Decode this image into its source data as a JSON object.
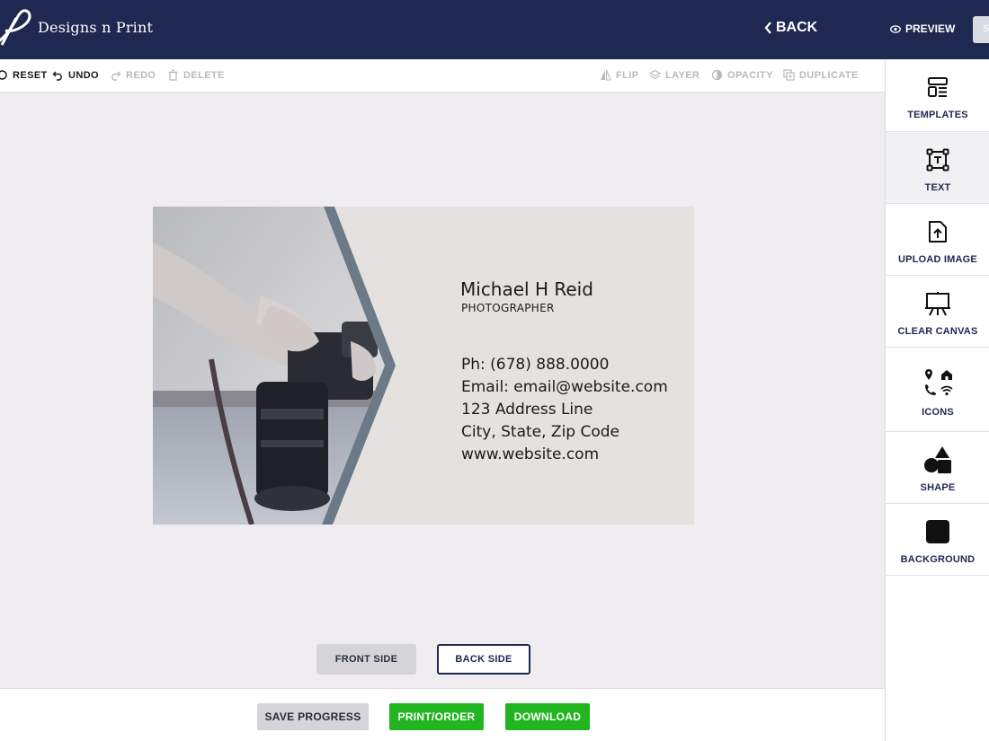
{
  "header": {
    "brand": "Designs n Print",
    "back_label": "BACK",
    "preview_label": "PREVIEW",
    "cut_button_label": "S"
  },
  "toolbar": {
    "reset": "RESET",
    "undo": "UNDO",
    "redo": "REDO",
    "delete": "DELETE",
    "flip": "FLIP",
    "layer": "LAYER",
    "opacity": "OPACITY",
    "duplicate": "DUPLICATE"
  },
  "card": {
    "name": "Michael H Reid",
    "title": "PHOTOGRAPHER",
    "phone": "Ph: (678) 888.0000",
    "email": "Email: email@website.com",
    "address": "123 Address Line",
    "city": "City, State, Zip Code",
    "website": "www.website.com",
    "accent_color": "#6b7a86"
  },
  "sides": {
    "front": "FRONT SIDE",
    "back": "BACK SIDE"
  },
  "bottom": {
    "save": "SAVE PROGRESS",
    "print": "PRINT/ORDER",
    "download": "DOWNLOAD"
  },
  "sidebar": {
    "items": [
      {
        "label": "TEMPLATES",
        "icon": "templates-icon"
      },
      {
        "label": "TEXT",
        "icon": "text-box-icon"
      },
      {
        "label": "UPLOAD IMAGE",
        "icon": "upload-file-icon"
      },
      {
        "label": "CLEAR CANVAS",
        "icon": "easel-icon"
      },
      {
        "label": "ICONS",
        "icon": "icons-grid-icon"
      },
      {
        "label": "SHAPE",
        "icon": "shapes-icon"
      },
      {
        "label": "BACKGROUND",
        "icon": "background-square-icon"
      }
    ]
  },
  "colors": {
    "header_bg": "#1e2850",
    "primary_green": "#21b51f",
    "navy_text": "#1e2850"
  }
}
